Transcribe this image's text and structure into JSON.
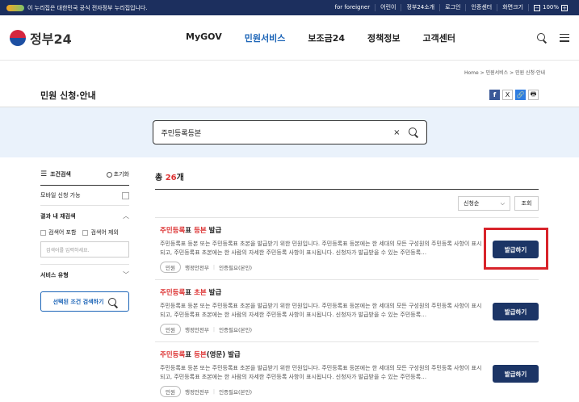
{
  "topbar": {
    "notice": "이 누리집은 대한민국 공식 전자정부 누리집입니다.",
    "links": [
      "for foreigner",
      "어린이",
      "정부24소개",
      "로그인",
      "인증센터",
      "화면크기"
    ],
    "zoom": "100%",
    "zoom_minus": "−",
    "zoom_plus": "+"
  },
  "header": {
    "logo": "정부24",
    "nav": [
      "MyGOV",
      "민원서비스",
      "보조금24",
      "정책정보",
      "고객센터"
    ],
    "active_nav": "민원서비스"
  },
  "breadcrumb": {
    "items": [
      "Home",
      "민원서비스",
      "민원 신청·안내"
    ],
    "separator": ">"
  },
  "page": {
    "title": "민원 신청·안내"
  },
  "share": {
    "facebook": "f",
    "x": "X",
    "link": "🔗",
    "print": "🖶"
  },
  "search": {
    "value": "주민등록등본",
    "clear": "×"
  },
  "sidebar": {
    "title": "조건검색",
    "reset": "초기화",
    "mobile_label": "모바일 신청 가능",
    "refine_label": "결과 내 재검색",
    "include_label": "검색어 포함",
    "exclude_label": "검색어 제외",
    "input_placeholder": "검색어를 입력하세요.",
    "service_type": "서비스 유형",
    "search_btn": "선택된 조건 검색하기"
  },
  "results": {
    "count_prefix": "총 ",
    "count": "26",
    "count_suffix": "개",
    "sort": "신청순",
    "query_btn": "조회",
    "items": [
      {
        "title_hl1": "주민등록",
        "title_mid": "표 ",
        "title_hl2": "등본",
        "title_rest": " 발급",
        "desc": "주민등록표 등본 또는 주민등록표 초본을 발급받기 위한 민원입니다. 주민등록표 등본에는 한 세대의 모든 구성원의 주민등록 사항이 표시되고, 주민등록표 초본에는 한 사람의 자세한 주민등록 사항이 표시됩니다. 신청자가 발급받을 수 있는 주민등록…",
        "tag": "민원",
        "agency": "행정안전부",
        "auth": "인증필요(본인)",
        "button": "발급하기"
      },
      {
        "title_hl1": "주민등록",
        "title_mid": "표 ",
        "title_hl2": "초본",
        "title_rest": " 발급",
        "desc": "주민등록표 등본 또는 주민등록표 초본을 발급받기 위한 민원입니다. 주민등록표 등본에는 한 세대의 모든 구성원의 주민등록 사항이 표시되고, 주민등록표 초본에는 한 사람의 자세한 주민등록 사항이 표시됩니다. 신청자가 발급받을 수 있는 주민등록…",
        "tag": "민원",
        "agency": "행정안전부",
        "auth": "인증필요(본인)",
        "button": "발급하기"
      },
      {
        "title_hl1": "주민등록",
        "title_mid": "표 ",
        "title_hl2": "등본",
        "title_rest": "(영문) 발급",
        "desc": "주민등록표 등본 또는 주민등록표 초본을 발급받기 위한 민원입니다. 주민등록표 등본에는 한 세대의 모든 구성원의 주민등록 사항이 표시되고, 주민등록표 초본에는 한 사람의 자세한 주민등록 사항이 표시됩니다. 신청자가 발급받을 수 있는 주민등록…",
        "tag": "민원",
        "agency": "행정안전부",
        "auth": "인증필요(본인)",
        "button": "발급하기"
      }
    ]
  },
  "colors": {
    "navy": "#1c2f5e",
    "accent": "#1b64b7",
    "red": "#d33",
    "button": "#1c3566",
    "highlight": "#d8232a"
  }
}
